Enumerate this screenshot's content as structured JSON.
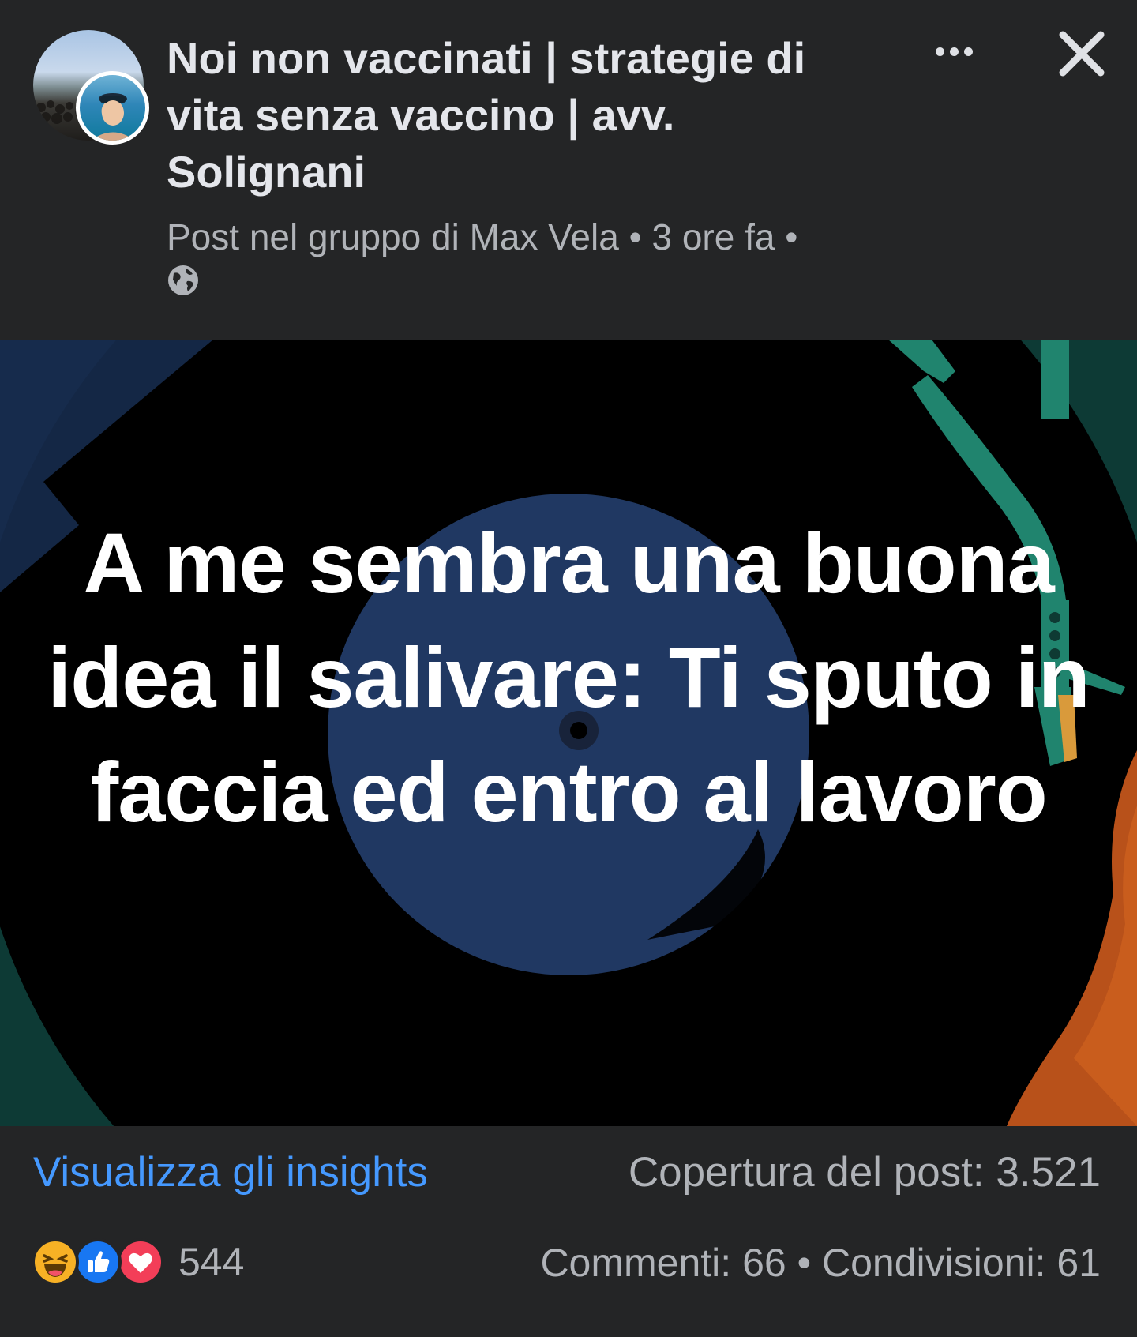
{
  "post": {
    "group_name": "Noi non vaccinati | strategie di vita senza vaccino | avv. Solignani",
    "meta": "Post nel gruppo di Max Vela • 3 ore fa •",
    "audience_icon": "globe-icon",
    "image_text": "A me sembra una buona idea il salivare: Ti sputo in faccia ed entro al lavoro"
  },
  "header": {
    "more_icon": "more-options-icon",
    "close_icon": "close-icon"
  },
  "insights": {
    "link_label": "Visualizza gli insights",
    "reach_text": "Copertura del post: 3.521"
  },
  "stats": {
    "reactions": [
      "haha",
      "like",
      "love"
    ],
    "reaction_count": "544",
    "comments": "Commenti: 66",
    "separator": "•",
    "shares": "Condivisioni: 61"
  },
  "colors": {
    "background": "#242526",
    "link": "#4599ff",
    "secondary_text": "#b0b3b8",
    "primary_text": "#e4e6eb"
  }
}
